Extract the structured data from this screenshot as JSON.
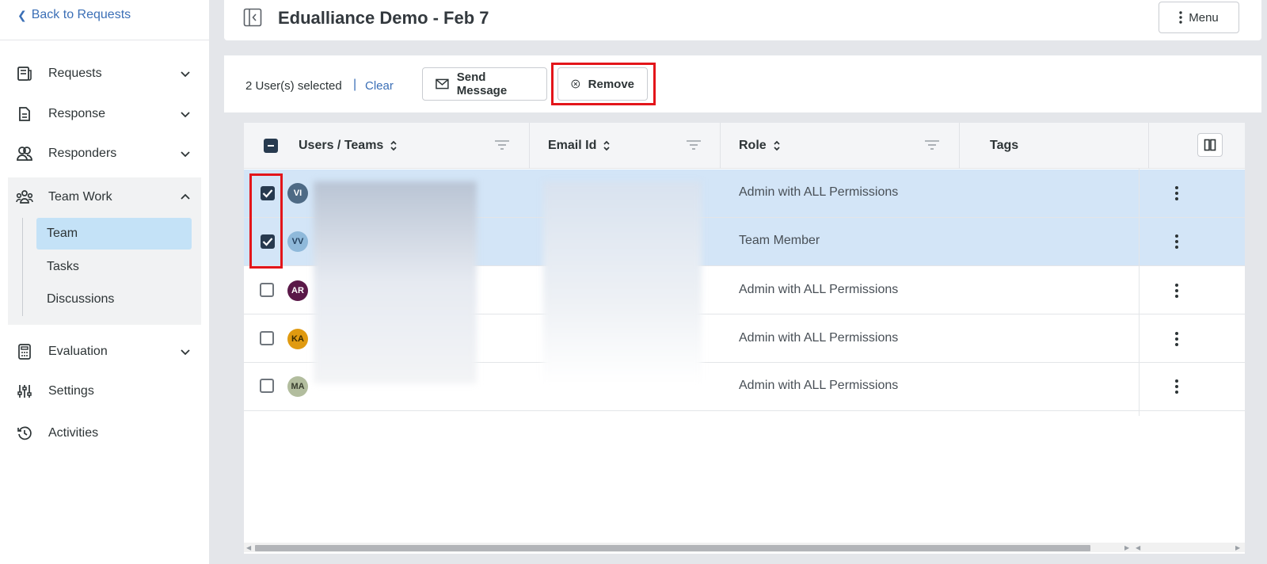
{
  "sidebar": {
    "back_label": "Back to Requests",
    "items": [
      {
        "label": "Requests",
        "icon": "requests-icon"
      },
      {
        "label": "Response",
        "icon": "document-icon"
      },
      {
        "label": "Responders",
        "icon": "users-icon"
      },
      {
        "label": "Team Work",
        "icon": "team-icon"
      },
      {
        "label": "Evaluation",
        "icon": "calculator-icon"
      },
      {
        "label": "Settings",
        "icon": "sliders-icon"
      },
      {
        "label": "Activities",
        "icon": "history-icon"
      }
    ],
    "sub_items": [
      {
        "label": "Team",
        "active": true
      },
      {
        "label": "Tasks",
        "active": false
      },
      {
        "label": "Discussions",
        "active": false
      }
    ]
  },
  "header": {
    "title": "Edualliance Demo - Feb 7",
    "menu_label": "Menu"
  },
  "actions": {
    "selected_text": "2 User(s) selected",
    "separator": "|",
    "clear_label": "Clear",
    "send_message_label": "Send Message",
    "remove_label": "Remove"
  },
  "table": {
    "columns": [
      "Users / Teams",
      "Email Id",
      "Role",
      "Tags"
    ],
    "rows": [
      {
        "initials": "VI",
        "avatar_color": "#4e6a85",
        "avatar_text": "#ffffff",
        "role": "Admin with ALL Permissions",
        "checked": true
      },
      {
        "initials": "VV",
        "avatar_color": "#8fb9da",
        "avatar_text": "#24415e",
        "role": "Team Member",
        "checked": true
      },
      {
        "initials": "AR",
        "avatar_color": "#5a1848",
        "avatar_text": "#ffffff",
        "role": "Admin with ALL Permissions",
        "checked": false
      },
      {
        "initials": "KA",
        "avatar_color": "#e09a10",
        "avatar_text": "#3a2a00",
        "role": "Admin with ALL Permissions",
        "checked": false
      },
      {
        "initials": "MA",
        "avatar_color": "#b2bd9e",
        "avatar_text": "#3a3f30",
        "role": "Admin with ALL Permissions",
        "checked": false
      }
    ]
  },
  "colors": {
    "accent": "#3b6fb6",
    "selected_row": "#d3e5f7",
    "active_nav": "#c4e2f7",
    "highlight": "#e3151a",
    "checkbox_checked": "#273a4f"
  }
}
